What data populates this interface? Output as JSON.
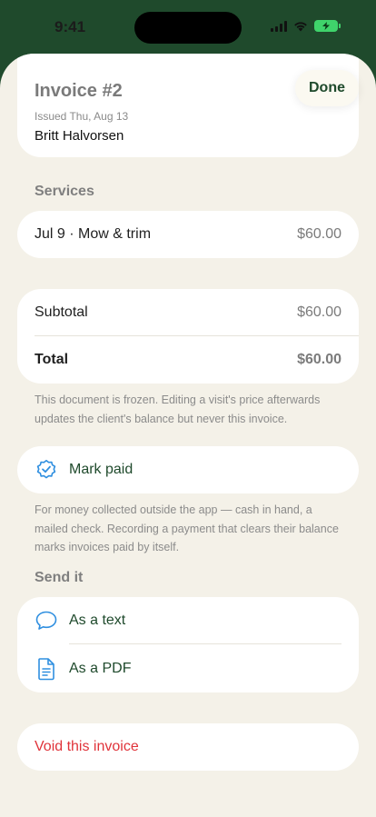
{
  "status_bar": {
    "time": "9:41"
  },
  "header": {
    "title": "Invoice #2",
    "issued": "Issued Thu, Aug 13",
    "client": "Britt Halvorsen",
    "done_label": "Done"
  },
  "services": {
    "section_title": "Services",
    "items": [
      {
        "label": "Jul 9 · Mow & trim",
        "amount": "$60.00"
      }
    ]
  },
  "totals": {
    "subtotal_label": "Subtotal",
    "subtotal_amount": "$60.00",
    "total_label": "Total",
    "total_amount": "$60.00"
  },
  "frozen_note": "This document is frozen. Editing a visit's price afterwards updates the client's balance but never this invoice.",
  "mark_paid": {
    "label": "Mark paid",
    "note": "For money collected outside the app — cash in hand, a mailed check. Recording a payment that clears their balance marks invoices paid by itself."
  },
  "send": {
    "section_title": "Send it",
    "text_label": "As a text",
    "pdf_label": "As a PDF"
  },
  "void": {
    "label": "Void this invoice"
  },
  "colors": {
    "accent_green": "#1f4a2c",
    "icon_blue": "#2f8fe0",
    "destructive_red": "#e0333a",
    "battery_green": "#3fd36b"
  }
}
